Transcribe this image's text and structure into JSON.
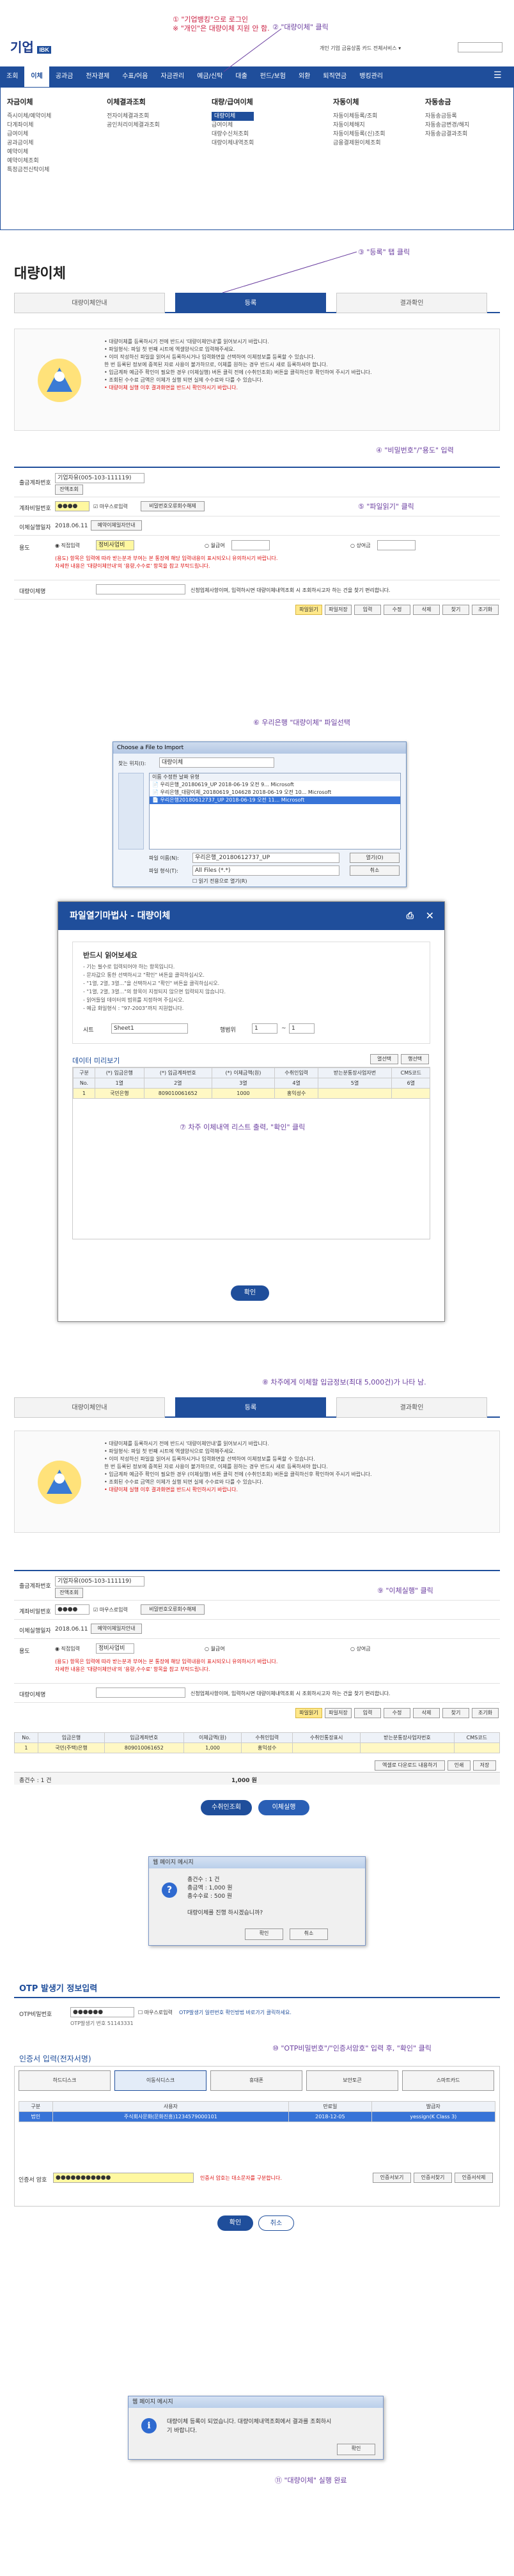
{
  "annotations": {
    "a1_line1": "① \"기업뱅킹\"으로 로그인",
    "a1_line2": "※ \"개인\"은 대량이체 지원 안 함.",
    "a2": "② \"대량이체\" 클릭",
    "a3": "③ \"등록\" 탭 클릭",
    "a4": "④ \"비밀번호\"/\"용도\" 입력",
    "a5": "⑤ \"파일읽기\" 클릭",
    "a6": "⑥ 우리은행 \"대량이체\" 파일선택",
    "a7": "⑦ 차주 이체내역 리스트 출력, \"확인\" 클릭",
    "a8": "⑧ 차주에게 이체할 입금정보(최대 5,000건)가 나타 남.",
    "a9": "⑨ \"이체실행\" 클릭",
    "a10": "⑩ \"OTP비밀번호\"/\"인증서암호\" 입력 후, \"확인\" 클릭",
    "a11": "⑪ \"대량이체\" 실행 완료"
  },
  "header": {
    "logo": "기업",
    "logo_tag": "IBK",
    "top_links": "개인  기업  금융상품  카드  전체서비스 ▾",
    "nav": [
      "조회",
      "이체",
      "공과금",
      "전자결제",
      "수표/어음",
      "자금관리",
      "예금/신탁",
      "대출",
      "펀드/보험",
      "외환",
      "퇴직연금",
      "뱅킹관리"
    ],
    "nav_active_index": 1
  },
  "mega": {
    "cols": [
      {
        "title": "자금이체",
        "items": [
          "즉시이체/예약이체",
          "다계좌이체",
          "급여이체",
          "공과금이체",
          "예약이체",
          "예약이체조회",
          "특정금전신탁이체"
        ]
      },
      {
        "title": "이체결과조회",
        "items": [
          "전자이체결과조회",
          "공인처리이체결과조회"
        ]
      },
      {
        "title": "대량/급여이체",
        "items": [
          "대량이체",
          "급여이체",
          "대량수신처조회",
          "대량이체내역조회"
        ],
        "selected": 0
      },
      {
        "title": "자동이체",
        "items": [
          "자동이체등록/조회",
          "자동이체해지",
          "자동이체등록(신)조회",
          "금융결제원이체조회"
        ]
      },
      {
        "title": "자동송금",
        "items": [
          "자동송금등록",
          "자동송금변경/해지",
          "자동송금결과조회"
        ]
      }
    ]
  },
  "page": {
    "title": "대량이체",
    "tabs": [
      "대량이체안내",
      "등록",
      "결과확인"
    ],
    "tab_active_index": 1
  },
  "notice": {
    "items": [
      "• 대량이체를 등록하시기 전에 반드시 '대량이체안내'를 읽어보시기 바랍니다.",
      "• 파일형식: 파일 첫 번째 시트에 엑셀양식으로 입력해주세요.",
      "• 이미 작성하신 파일을 읽어서 등록하시거나 입력화면을 선택하여 이체정보를 등록할 수 있습니다.",
      "  한 번 등록된 정보에 중복된 자료 사용이 불가하므로, 이체를 원하는 경우 반드시 새로 등록하셔야 합니다.",
      "• 입금계좌 예금주 확인이 필요한 경우 (이체실행) 버튼 클릭 전에 (수취인조회) 버튼을 클릭하신후 확인하여 주시기 바랍니다.",
      "• 조회된 수수료 금액은 이체가 실행 되면 실제 수수료와 다를 수 있습니다.",
      "• 대량이체 실행 이후 결과화면을 반드시 확인하시기 바랍니다."
    ],
    "red_index": 6
  },
  "form": {
    "account_label": "출금계좌번호",
    "account_value": "기업자유(005-103-111119)",
    "account_btn": "잔액조회",
    "pwd_label": "계좌비밀번호",
    "pwd_value": "●●●●",
    "mouse_input": "마우스로입력",
    "pwd_btn": "비밀번호오류회수해제",
    "date_label": "이체실행일자",
    "date_value": "2018.06.11",
    "date_btn": "예약이체일자안내",
    "use_label": "용도",
    "use_options": [
      "직접입력",
      "월급여",
      "상여금"
    ],
    "use_value": "정비사업비",
    "warning_1": "(용도) 항목은 입력에 따라 받는분과 부여는 본 통장에 해당 입력내용이 표시되오니 유의하시기 바랍니다.",
    "warning_2": "자세한 내용은 '대량이체안내'의 '용량,수수료' 항목을 참고 부탁드립니다.",
    "memo_label": "대량이체명",
    "memo_hint": "신청업체사항이며, 입력하시면 대량이체내역조회 시 조회하시고자 하는 건을 찾기 편리합니다.",
    "action_buttons": [
      "파일읽기",
      "파일저장",
      "입력",
      "수정",
      "삭제",
      "찾기",
      "조기화"
    ]
  },
  "file_dialog": {
    "title": "Choose a File to Import",
    "look_in_label": "찾는 위치(I):",
    "look_in_value": "대량이체",
    "columns": [
      "이름",
      "수정한 날짜",
      "유형"
    ],
    "files": [
      {
        "name": "우리은행_20180619_UP",
        "date": "2018-06-19 오전 9...",
        "type": "Microsoft"
      },
      {
        "name": "우리은행_대량이체_20180619_104628",
        "date": "2018-06-19 오전 10...",
        "type": "Microsoft"
      },
      {
        "name": "우리은행20180612737_UP",
        "date": "2018-06-19 오전 11...",
        "type": "Microsoft"
      }
    ],
    "highlight_index": 2,
    "filename_label": "파일 이름(N):",
    "filename_value": "우리은행_20180612737_UP",
    "filetype_label": "파일 형식(T):",
    "filetype_value": "All Files (*.*)",
    "readonly_label": "읽기 전용으로 열기(R)",
    "open_btn": "열기(O)",
    "cancel_btn": "취소"
  },
  "popup": {
    "title": "파일열기마법사 - 대량이체",
    "notice_title": "반드시 읽어보세요",
    "notice_items": [
      "- 기는 필수로 입력되어야 하는 항목입니다.",
      "- 문자값으 통한 선택하시고 \"확인\" 버튼을 클릭하십시오.",
      "- \"1열, 2열, 3열...\"을 선택하시고 \"확인\" 버튼을 클릭하십시오.",
      "- \"1열, 2열, 3열...\"의 항목이 지정되지 않으면 입력되지 않습니다.",
      "- 읽어들일 데이터의 범위를 지정하여 주십시오.",
      "- 예금 화일형식 : \"97-2003\"까지 지원합니다."
    ],
    "sheet_label": "시트",
    "sheet_value": "Sheet1",
    "range_label": "행범위",
    "range_from": "1",
    "range_to": "1",
    "preview_title": "데이터 미리보기",
    "preview_btns": [
      "열선택",
      "행선택"
    ],
    "headers": [
      "구분",
      "(*) 입금은행",
      "(*) 입금계좌번호",
      "(*) 이체금액(원)",
      "수취인입력",
      "받는분통장사업자번",
      "CMS코드"
    ],
    "subheaders": [
      "No.",
      "1열",
      "2열",
      "3열",
      "4열",
      "5열",
      "6열"
    ],
    "row": [
      "1",
      "국민은행",
      "809010061652",
      "1000",
      "홍익성수",
      "",
      ""
    ],
    "confirm_btn": "확인"
  },
  "form2": {
    "pwd_value": "●●●●",
    "action_buttons": [
      "파일읽기",
      "파일저장",
      "입력",
      "수정",
      "삭제",
      "찾기",
      "조기화"
    ],
    "table_headers": [
      "No.",
      "입금은행",
      "입금계좌번호",
      "이체금액(원)",
      "수취인입력",
      "수취인통장표시",
      "받는분통장사업자번호",
      "CMS코드"
    ],
    "table_row": [
      "1",
      "국민(주택)은행",
      "809010061652",
      "1,000",
      "홍익성수",
      "",
      "",
      ""
    ],
    "summary_count": "총건수 : 1 건",
    "summary_amount": "1,000 원",
    "mini_btns": [
      "엑셀로 다운로드 내용하기",
      "인쇄",
      "저장"
    ],
    "btn_lookup": "수취인조회",
    "btn_execute": "이체실행"
  },
  "confirm_alert": {
    "title": "웹 페이지 메시지",
    "lines": [
      "총건수 : 1 건",
      "총금액 : 1,000 원",
      "총수수료 : 500 원",
      "",
      "대량이체를 진행 하시겠습니까?"
    ],
    "ok": "확인",
    "cancel": "취소"
  },
  "otp": {
    "title": "OTP 발생기 정보입력",
    "otp_label": "OTP비밀번호",
    "otp_value": "●●●●●●",
    "otp_hint": "OTP발생기 번호 51143331",
    "otp_mouse": "마우스로입력",
    "otp_note": "OTP발생기 일련번호 확인방법 바로가기 클릭하세요.",
    "cert_title": "인증서 입력(전자서명)",
    "cert_tabs": [
      "하드디스크",
      "이동식디스크",
      "휴대폰",
      "보안토큰",
      "스마트카드"
    ],
    "cert_headers": [
      "구분",
      "사용자",
      "만료일",
      "발급자"
    ],
    "cert_row": [
      "법인",
      "주식회사문화(문화진흥)1234579000101",
      "2018-12-05",
      "yessign(K Class 3)"
    ],
    "pwd_label": "인증서 암호",
    "pwd_value": "●●●●●●●●●●●",
    "pwd_note": "인증서 암호는 대소문자를 구분합니다.",
    "side_btns": [
      "인증서보기",
      "인증서찾기",
      "인증서삭제"
    ],
    "ok": "확인",
    "cancel": "취소"
  },
  "done_alert": {
    "title": "웹 페이지 메시지",
    "line1": "대량이체 등록이 되었습니다. 대량이체내역조회에서 결과를 조회하시",
    "line2": "기 바랍니다.",
    "ok": "확인"
  },
  "colors": {
    "brand": "#1f4e9b",
    "annotation": "#6b3fa0",
    "highlight": "#fff8c4"
  }
}
